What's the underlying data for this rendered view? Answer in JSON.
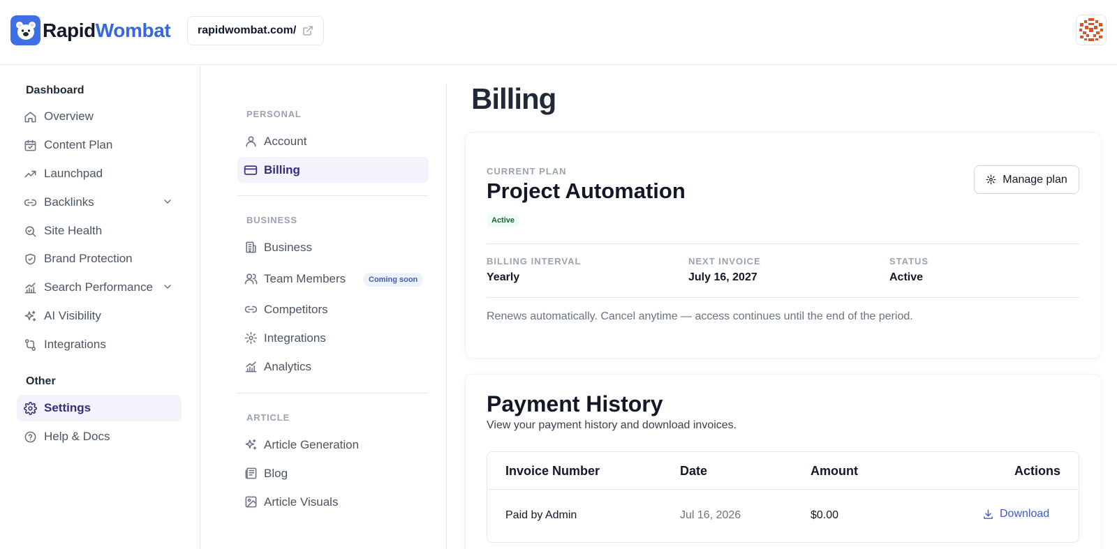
{
  "brand": {
    "name_part1": "Rapid",
    "name_part2": "Wombat"
  },
  "header": {
    "domain": "rapidwombat.com/"
  },
  "colors": {
    "accent": "#3f6fe4",
    "active_nav_bg": "#f4f2fb",
    "active_nav_text": "#312e81",
    "link": "#3b5bdb"
  },
  "sidebar": {
    "section_dashboard": "Dashboard",
    "items": [
      {
        "label": "Overview",
        "icon": "home-icon"
      },
      {
        "label": "Content Plan",
        "icon": "calendar-icon"
      },
      {
        "label": "Launchpad",
        "icon": "trending-up-icon"
      },
      {
        "label": "Backlinks",
        "icon": "link-icon"
      },
      {
        "label": "Site Health",
        "icon": "search-icon"
      },
      {
        "label": "Brand Protection",
        "icon": "shield-check-icon"
      },
      {
        "label": "Search Performance",
        "icon": "bar-chart-icon"
      },
      {
        "label": "AI Visibility",
        "icon": "sparkles-icon"
      },
      {
        "label": "Integrations",
        "icon": "git-branch-icon"
      }
    ],
    "section_other": "Other",
    "other_items": [
      {
        "label": "Settings",
        "icon": "gear-icon",
        "active": true
      },
      {
        "label": "Help & Docs",
        "icon": "help-circle-icon"
      }
    ]
  },
  "settings_nav": {
    "personal_title": "PERSONAL",
    "personal": [
      {
        "label": "Account",
        "icon": "user-icon"
      },
      {
        "label": "Billing",
        "icon": "credit-card-icon",
        "active": true
      }
    ],
    "business_title": "BUSINESS",
    "business": [
      {
        "label": "Business",
        "icon": "building-icon"
      },
      {
        "label": "Team Members",
        "icon": "users-icon",
        "badge": "Coming soon"
      },
      {
        "label": "Competitors",
        "icon": "link-icon"
      },
      {
        "label": "Integrations",
        "icon": "gear-icon"
      },
      {
        "label": "Analytics",
        "icon": "bar-chart-icon"
      }
    ],
    "article_title": "ARTICLE",
    "article": [
      {
        "label": "Article Generation",
        "icon": "sparkles-icon"
      },
      {
        "label": "Blog",
        "icon": "newspaper-icon"
      },
      {
        "label": "Article Visuals",
        "icon": "image-icon"
      }
    ]
  },
  "main": {
    "title": "Billing",
    "plan": {
      "current_plan_label": "CURRENT PLAN",
      "name": "Project Automation",
      "badge": "Active",
      "manage_button": "Manage plan",
      "billing_interval_label": "BILLING INTERVAL",
      "billing_interval": "Yearly",
      "next_invoice_label": "NEXT INVOICE",
      "next_invoice": "July 16, 2027",
      "status_label": "STATUS",
      "status": "Active",
      "renew_note": "Renews automatically. Cancel anytime — access continues until the end of the period."
    },
    "history": {
      "title": "Payment History",
      "subtitle": "View your payment history and download invoices.",
      "columns": [
        "Invoice Number",
        "Date",
        "Amount",
        "Actions"
      ],
      "rows": [
        {
          "invoice": "Paid by Admin",
          "date": "Jul 16, 2026",
          "amount": "$0.00",
          "action": "Download"
        }
      ]
    }
  }
}
